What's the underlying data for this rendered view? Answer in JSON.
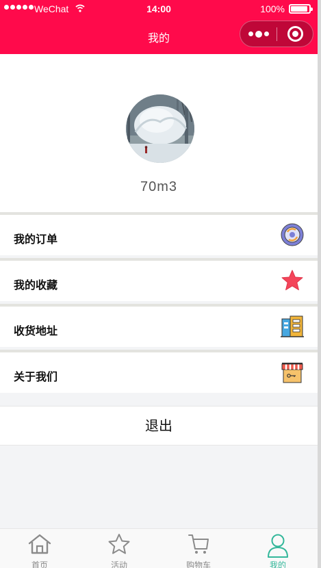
{
  "status_bar": {
    "carrier": "WeChat",
    "time": "14:00",
    "battery": "100%"
  },
  "header": {
    "title": "我的"
  },
  "profile": {
    "username": "70m3"
  },
  "menu": {
    "items": [
      {
        "label": "我的订单",
        "icon": "orders-icon"
      },
      {
        "label": "我的收藏",
        "icon": "star-icon"
      },
      {
        "label": "收货地址",
        "icon": "building-icon"
      },
      {
        "label": "关于我们",
        "icon": "shop-icon"
      }
    ]
  },
  "logout": {
    "label": "退出"
  },
  "tabbar": {
    "tabs": [
      {
        "label": "首页",
        "icon": "home-icon"
      },
      {
        "label": "活动",
        "icon": "star-outline-icon"
      },
      {
        "label": "购物车",
        "icon": "cart-icon"
      },
      {
        "label": "我的",
        "icon": "user-icon"
      }
    ],
    "active_color": "#33b79a",
    "inactive_color": "#8a8a8a"
  },
  "colors": {
    "brand": "#ff0a4b",
    "background": "#f3f4f6"
  }
}
